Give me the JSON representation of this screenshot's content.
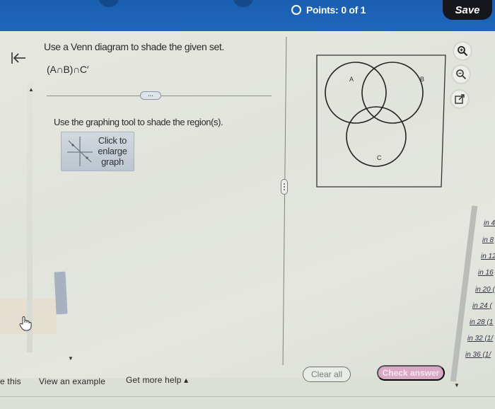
{
  "header": {
    "points_label": "Points:",
    "points_value": "0 of 1",
    "save_label": "Save"
  },
  "question": {
    "title": "Use a Venn diagram to shade the given set.",
    "expression": "(A∩B)∩C′",
    "more_label": "…",
    "instruction": "Use the graphing tool to shade the region(s).",
    "enlarge_line1": "Click to",
    "enlarge_line2": "enlarge",
    "enlarge_line3": "graph"
  },
  "venn": {
    "sets": [
      {
        "label": "A"
      },
      {
        "label": "B"
      },
      {
        "label": "C"
      }
    ],
    "shaded_regions": []
  },
  "tools": {
    "zoom_in": "zoom-in-icon",
    "zoom_out": "zoom-out-icon",
    "popout": "popout-icon"
  },
  "right_list": [
    "in 4",
    "in 8",
    "in 12",
    "in 16",
    "in 20 (",
    "in 24 (",
    "in 28 (1",
    "in 32 (1/",
    "in 36 (1/"
  ],
  "footer": {
    "partial_link": "e this",
    "view_example": "View an example",
    "get_help": "Get more help ▴",
    "clear_all": "Clear all",
    "check_answer": "Check answer"
  },
  "colors": {
    "header_blue": "#1e66bd",
    "save_bg": "#15171c",
    "check_answer_bg": "#d9a8c4"
  }
}
